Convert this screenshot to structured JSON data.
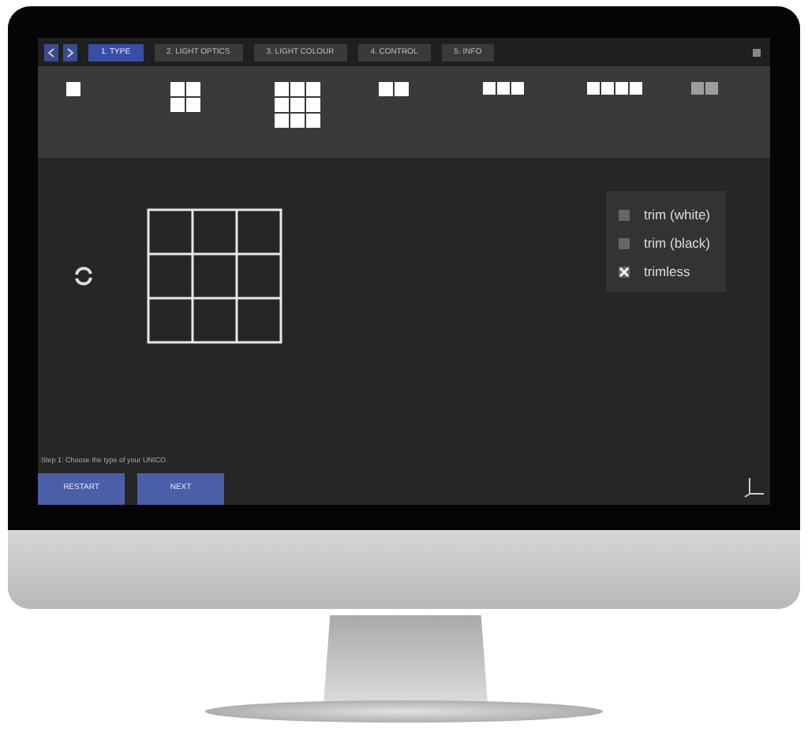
{
  "tabs": [
    {
      "label": "1. TYPE",
      "selected": true
    },
    {
      "label": "2. LIGHT OPTICS",
      "selected": false
    },
    {
      "label": "3. LIGHT COLOUR",
      "selected": false
    },
    {
      "label": "4. CONTROL",
      "selected": false
    },
    {
      "label": "5. INFO",
      "selected": false
    }
  ],
  "tiles": [
    {
      "kind": "single"
    },
    {
      "kind": "square4"
    },
    {
      "kind": "square9"
    },
    {
      "kind": "row2"
    },
    {
      "kind": "row3"
    },
    {
      "kind": "row4"
    },
    {
      "kind": "edge"
    }
  ],
  "options": [
    {
      "label": "trim (white)",
      "checked": false
    },
    {
      "label": "trim (black)",
      "checked": false
    },
    {
      "label": "trimless",
      "checked": true
    }
  ],
  "step_text": "Step 1: Choose the type of your UNICO.",
  "buttons": [
    "RESTART",
    "NEXT"
  ]
}
